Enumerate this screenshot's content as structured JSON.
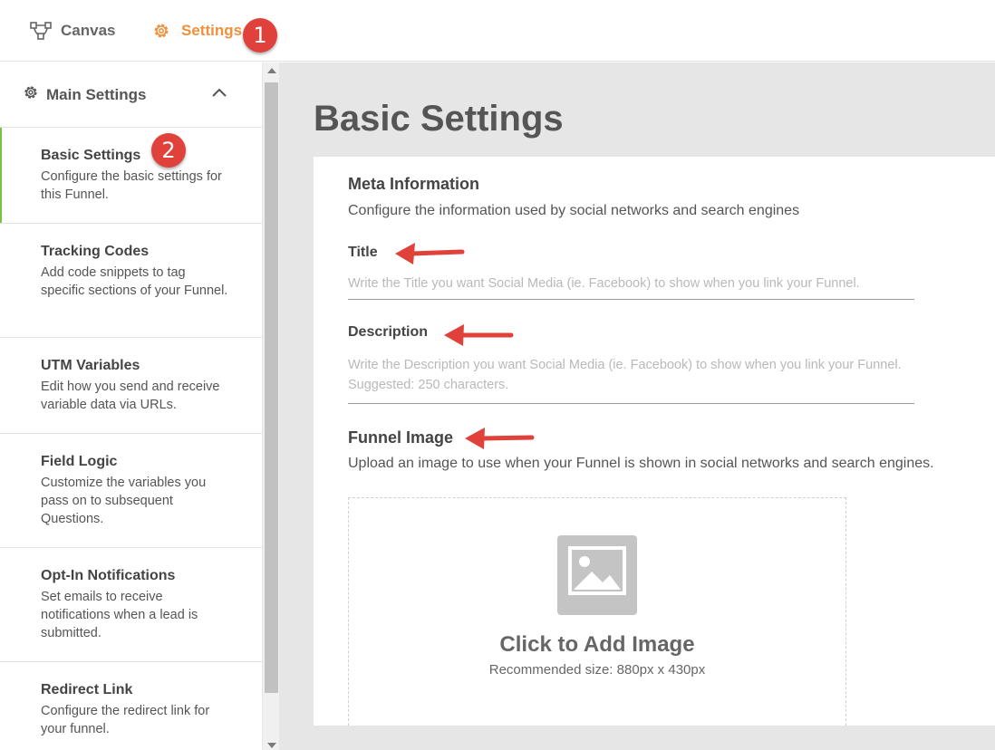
{
  "topbar": {
    "tabs": [
      {
        "label": "Canvas",
        "icon": "canvas-icon"
      },
      {
        "label": "Settings",
        "icon": "gear-icon"
      }
    ],
    "badge_1": "1"
  },
  "sidebar": {
    "header_label": "Main Settings",
    "badge_2": "2",
    "items": [
      {
        "title": "Basic Settings",
        "desc": "Configure the basic settings for this Funnel."
      },
      {
        "title": "Tracking Codes",
        "desc": "Add code snippets to tag specific sections of your Funnel."
      },
      {
        "title": "UTM Variables",
        "desc": "Edit how you send and receive variable data via URLs."
      },
      {
        "title": "Field Logic",
        "desc": "Customize the variables you pass on to subsequent Questions."
      },
      {
        "title": "Opt-In Notifications",
        "desc": "Set emails to receive notifications when a lead is submitted."
      },
      {
        "title": "Redirect Link",
        "desc": "Configure the redirect link for your funnel."
      }
    ]
  },
  "main": {
    "page_title": "Basic Settings",
    "meta": {
      "title": "Meta Information",
      "desc": "Configure the information used by social networks and search engines"
    },
    "title_field": {
      "label": "Title",
      "placeholder": "Write the Title you want Social Media (ie. Facebook) to show when you link your Funnel."
    },
    "description_field": {
      "label": "Description",
      "placeholder": "Write the Description you want Social Media (ie. Facebook) to show when you link your Funnel. Suggested: 250 characters."
    },
    "funnel_image": {
      "label": "Funnel Image",
      "desc": "Upload an image to use when your Funnel is shown in social networks and search engines.",
      "cta": "Click to Add Image",
      "hint": "Recommended size: 880px x 430px"
    }
  },
  "colors": {
    "accent": "#f0903c",
    "badge": "#e0413b",
    "active_bar": "#7cc242",
    "arrow": "#e0413b"
  }
}
